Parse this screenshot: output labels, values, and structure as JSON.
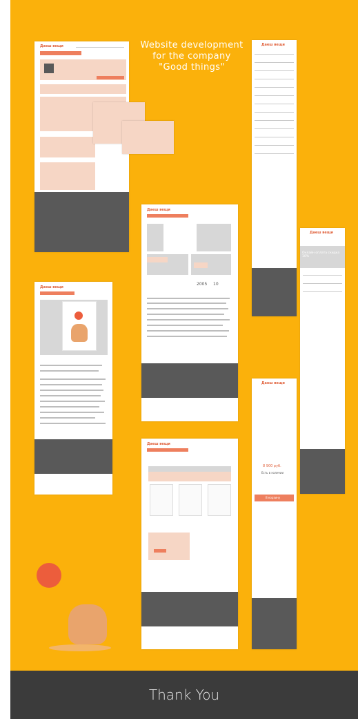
{
  "headline": {
    "line1": "Website development",
    "line2": "for the company",
    "line3": "\"Good things\""
  },
  "footer": {
    "label": "Thank You"
  },
  "mockups": {
    "logo_text": "Даеш вещи",
    "mobile_promo": "Онлайн оплата скидка 10%",
    "mobile_price": "8 900 руб.",
    "mobile_stock": "Есть в наличии",
    "mobile_buy": "В корзину",
    "section_title": "О нашем магазине",
    "cert_badge": "10",
    "year_badge": "2005"
  },
  "colors": {
    "background": "#fbb10b",
    "accent": "#ee7f5e",
    "footer": "#3b3b3b",
    "mock_dark": "#595959"
  },
  "icons": {
    "mascot": "cat-with-balloon-icon",
    "logo_balloon": "balloon-v-icon",
    "product": "samovar-icon"
  }
}
